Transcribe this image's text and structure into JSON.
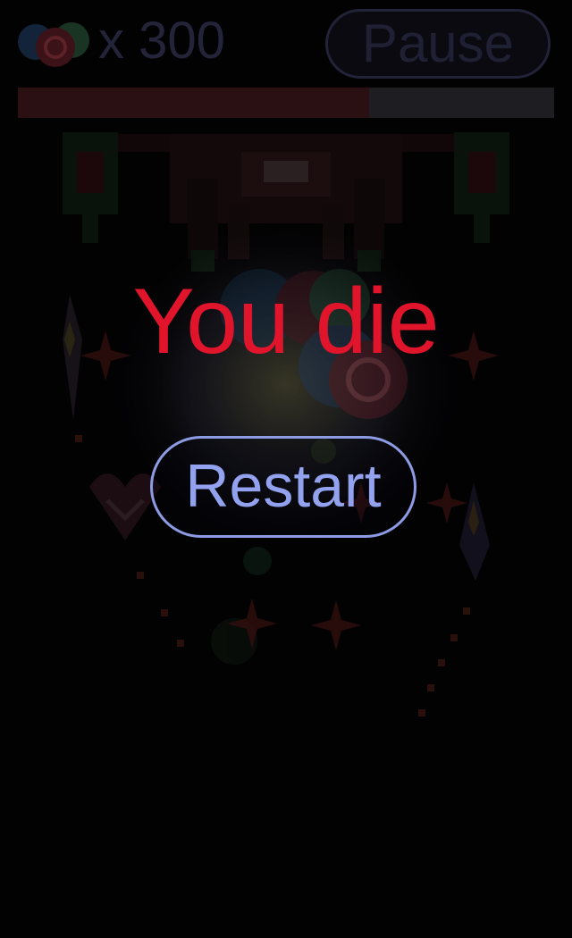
{
  "hud": {
    "coin_icon": "candy-coin-icon",
    "coin_count": "x 300",
    "pause_label": "Pause",
    "health_fraction": 0.655
  },
  "game_over": {
    "title": "You die",
    "restart_label": "Restart"
  },
  "colors": {
    "title": "#e0152b",
    "restart": "#93a2ee",
    "hud_text": "#23243a"
  }
}
